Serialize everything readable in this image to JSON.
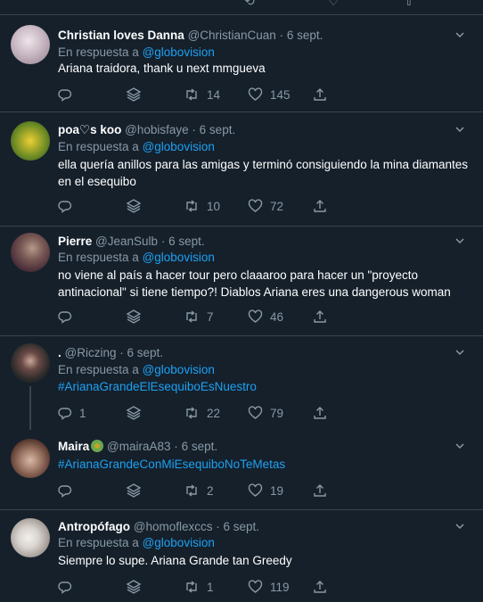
{
  "colors": {
    "background": "#15202b",
    "divider": "#38444d",
    "muted": "#8899a6",
    "link": "#1da1f2",
    "text": "#ffffff"
  },
  "reply_prefix": "En respuesta a",
  "separator": "·",
  "tweets": [
    {
      "name": "Christian loves Danna",
      "handle": "@ChristianCuan",
      "date": "6 sept.",
      "reply_to": "@globovision",
      "text": "Ariana traidora, thank u next mmgueva",
      "reply_count": "",
      "retweets": "14",
      "likes": "145",
      "avatar_color": "#c9b8c4"
    },
    {
      "name": "poa♡s koo",
      "handle": "@hobisfaye",
      "date": "6 sept.",
      "reply_to": "@globovision",
      "text": "ella quería anillos para las amigas y terminó consiguiendo la mina diamantes en el esequibo",
      "reply_count": "",
      "retweets": "10",
      "likes": "72",
      "avatar_color": "#8a9a2a"
    },
    {
      "name": "Pierre",
      "handle": "@JeanSulb",
      "date": "6 sept.",
      "reply_to": "@globovision",
      "text": "no viene al país a hacer tour pero claaaroo para hacer un \"proyecto antinacional\" si tiene tiempo?! Diablos Ariana eres una dangerous woman",
      "reply_count": "",
      "retweets": "7",
      "likes": "46",
      "avatar_color": "#6b4a4a"
    },
    {
      "name": ".",
      "handle": "@Riczing",
      "date": "6 sept.",
      "reply_to": "@globovision",
      "text": "#ArianaGrandeElEsequiboEsNuestro",
      "reply_count": "1",
      "retweets": "22",
      "likes": "79",
      "avatar_color": "#3a3a3a"
    },
    {
      "name": "Maira",
      "handle": "@mairaA83",
      "date": "6 sept.",
      "reply_to": "",
      "text": "#ArianaGrandeConMiEsequiboNoTeMetas",
      "reply_count": "",
      "retweets": "2",
      "likes": "19",
      "avatar_color": "#8a6a5a"
    },
    {
      "name": "Antropófago",
      "handle": "@homoflexccs",
      "date": "6 sept.",
      "reply_to": "@globovision",
      "text": "Siempre lo supe. Ariana Grande tan Greedy",
      "reply_count": "",
      "retweets": "1",
      "likes": "119",
      "avatar_color": "#d9d4d0"
    }
  ]
}
